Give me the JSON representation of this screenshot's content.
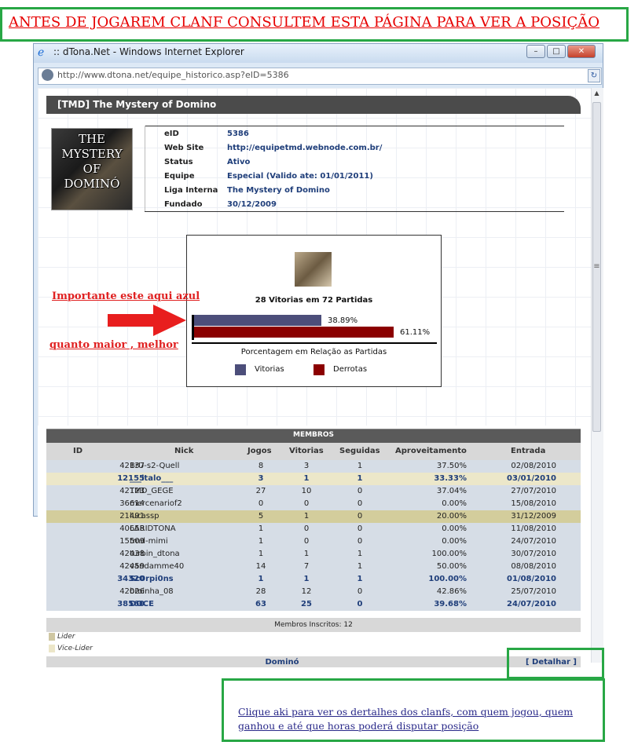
{
  "banner": {
    "text": "ANTES DE JOGAREM CLANF CONSULTEM ESTA PÁGINA PARA VER A POSIÇÃO"
  },
  "window": {
    "title": ":: dTona.Net - Windows Internet Explorer",
    "minimize": "–",
    "maximize": "□",
    "close": "✕",
    "address": "http://www.dtona.net/equipe_historico.asp?eID=5386"
  },
  "team": {
    "header": "[TMD] The Mystery of Domino",
    "logo_text": [
      "THE",
      "MYSTERY",
      "OF",
      "DOMINÓ"
    ],
    "info": [
      {
        "label": "eID",
        "value": "5386"
      },
      {
        "label": "Web Site",
        "value": "http://equipetmd.webnode.com.br/"
      },
      {
        "label": "Status",
        "value": "Ativo"
      },
      {
        "label": "Equipe",
        "value": "Especial (Valido ate: 01/01/2011)"
      },
      {
        "label": "Liga Interna",
        "value": "The Mystery of Domino"
      },
      {
        "label": "Fundado",
        "value": "30/12/2009"
      }
    ]
  },
  "chart_data": {
    "type": "bar",
    "title": "28 Vitorias em 72 Partidas",
    "subtitle": "Porcentagem em Relação as Partidas",
    "categories": [
      "Vitorias",
      "Derrotas"
    ],
    "values": [
      38.89,
      61.11
    ],
    "value_labels": [
      "38.89%",
      "61.11%"
    ],
    "colors": [
      "#4c4e7a",
      "#8b0000"
    ],
    "ylim": [
      0,
      65
    ],
    "legend": [
      {
        "name": "Vitorias",
        "color": "#4c4e7a"
      },
      {
        "name": "Derrotas",
        "color": "#8b0000"
      }
    ],
    "legend_position": "bottom"
  },
  "annotations": {
    "important": "Importante este aqui azul",
    "bigger": "quanto maior , melhor"
  },
  "members": {
    "title": "MEMBROS",
    "columns": [
      "ID",
      "Nick",
      "Jogos",
      "Vitorias",
      "Seguidas",
      "Aproveitamento",
      "Entrada"
    ],
    "rows": [
      {
        "id": "42137",
        "nick": "BrU-s2-Quell",
        "jogos": "8",
        "vitorias": "3",
        "seguidas": "1",
        "aprov": "37.50%",
        "entrada": "02/08/2010",
        "style": "plain"
      },
      {
        "id": "12155",
        "nick": "___italo___",
        "jogos": "3",
        "vitorias": "1",
        "seguidas": "1",
        "aprov": "33.33%",
        "entrada": "03/01/2010",
        "style": "lider"
      },
      {
        "id": "42123",
        "nick": "TMD_GEGE",
        "jogos": "27",
        "vitorias": "10",
        "seguidas": "0",
        "aprov": "37.04%",
        "entrada": "27/07/2010",
        "style": "plain"
      },
      {
        "id": "36614",
        "nick": "mercenariof2",
        "jogos": "0",
        "vitorias": "0",
        "seguidas": "0",
        "aprov": "0.00%",
        "entrada": "15/08/2010",
        "style": "plain"
      },
      {
        "id": "21491",
        "nick": "lucassp",
        "jogos": "5",
        "vitorias": "1",
        "seguidas": "0",
        "aprov": "20.00%",
        "entrada": "31/12/2009",
        "style": "vice"
      },
      {
        "id": "40658",
        "nick": "LARIDTONA",
        "jogos": "1",
        "vitorias": "0",
        "seguidas": "0",
        "aprov": "0.00%",
        "entrada": "11/08/2010",
        "style": "plain"
      },
      {
        "id": "15509",
        "nick": "tmd-mimi",
        "jogos": "1",
        "vitorias": "0",
        "seguidas": "0",
        "aprov": "0.00%",
        "entrada": "24/07/2010",
        "style": "plain"
      },
      {
        "id": "42438",
        "nick": "turbin_dtona",
        "jogos": "1",
        "vitorias": "1",
        "seguidas": "1",
        "aprov": "100.00%",
        "entrada": "30/07/2010",
        "style": "plain"
      },
      {
        "id": "42459",
        "nick": "vandamme40",
        "jogos": "14",
        "vitorias": "7",
        "seguidas": "1",
        "aprov": "50.00%",
        "entrada": "08/08/2010",
        "style": "plain"
      },
      {
        "id": "34320",
        "nick": "Sc0rpi0ns",
        "jogos": "1",
        "vitorias": "1",
        "seguidas": "1",
        "aprov": "100.00%",
        "entrada": "01/08/2010",
        "style": "bold"
      },
      {
        "id": "42026",
        "nick": "broinha_08",
        "jogos": "28",
        "vitorias": "12",
        "seguidas": "0",
        "aprov": "42.86%",
        "entrada": "25/07/2010",
        "style": "plain"
      },
      {
        "id": "38560",
        "nick": "DOCE",
        "jogos": "63",
        "vitorias": "25",
        "seguidas": "0",
        "aprov": "39.68%",
        "entrada": "24/07/2010",
        "style": "bold"
      }
    ],
    "summary": "Membros Inscritos: 12",
    "legend": [
      {
        "label": "Lider",
        "color": "#cfc7a2"
      },
      {
        "label": "Vice-Lider",
        "color": "#ece6c8"
      }
    ]
  },
  "footer": {
    "text": "Dominó",
    "detalhar": "[ Detalhar ]"
  },
  "info_box": {
    "text": "Clique aki para ver os dertalhes dos clanfs, com quem jogou, quem ganhou e até que horas poderá disputar posição"
  },
  "colors": {
    "green_box": "#28a745",
    "annotation_red": "#e02020",
    "link_blue": "#1f3e7a"
  }
}
